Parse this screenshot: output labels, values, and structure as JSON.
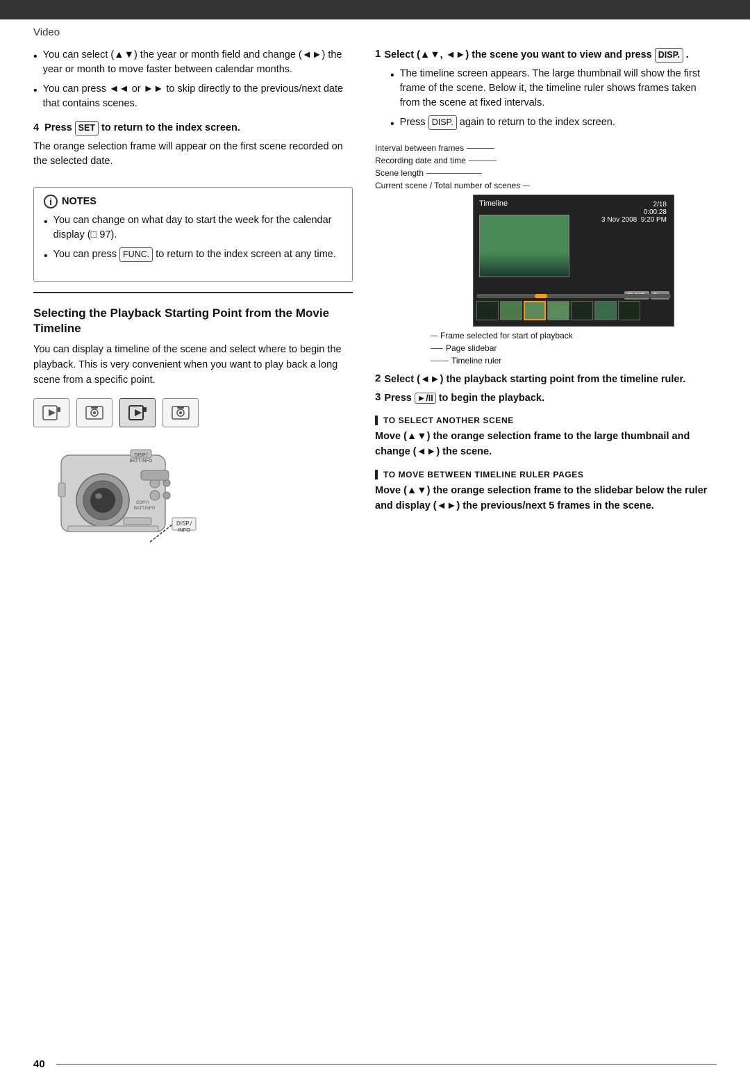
{
  "page": {
    "header": "Video",
    "page_number": "40",
    "top_bar_color": "#333"
  },
  "left_column": {
    "bullet_intro": {
      "items": [
        "You can select (▲▼) the year or month field and change (◄►) the year or month to move faster between calendar months.",
        "You can press ◄◄ or ►► to skip directly to the previous/next date that contains scenes."
      ]
    },
    "step4": {
      "heading": "4  Press SET to return to the index screen.",
      "body": "The orange selection frame will appear on the first scene recorded on the selected date."
    },
    "notes": {
      "title": "NOTES",
      "items": [
        "You can change on what day to start the week for the calendar display (□ 97).",
        "You can press FUNC. to return to the index screen at any time."
      ]
    },
    "section": {
      "heading": "Selecting the Playback Starting Point from the Movie Timeline",
      "body": "You can display a timeline of the scene and select where to begin the playback. This is very convenient when you want to play back a long scene from a specific point."
    },
    "mode_icons": [
      "▶□",
      "□",
      "▶□",
      "□"
    ],
    "mode_active_index": 2
  },
  "right_column": {
    "step1": {
      "num": "1",
      "heading": "Select (▲▼, ◄►) the scene you want to view and press DISP.",
      "bullets": [
        "The timeline screen appears. The large thumbnail will show the first frame of the scene. Below it, the timeline ruler shows frames taken from the scene at fixed intervals.",
        "Press DISP. again to return to the index screen."
      ]
    },
    "diagram": {
      "title": "Timeline",
      "date": "2/18",
      "time": "0:00:28",
      "date2": "3 Nov 2008  9:20 PM",
      "func_btn": "FUNC.",
      "sec_btn": "6sec",
      "callout_labels_top": [
        "Interval between frames",
        "Recording date and time",
        "Scene length",
        "Current scene / Total number of scenes"
      ],
      "callout_labels_bottom": [
        "Frame selected for start of playback",
        "Page slidebar",
        "Timeline ruler"
      ]
    },
    "step2": {
      "num": "2",
      "text": "Select (◄►) the playback starting point from the timeline ruler."
    },
    "step3": {
      "num": "3",
      "text": "Press ►/II to begin the playback."
    },
    "to_select_another": {
      "label": "TO SELECT ANOTHER SCENE",
      "text": "Move (▲▼) the orange selection frame to the large thumbnail and change (◄►) the scene."
    },
    "to_move_between": {
      "label": "TO MOVE BETWEEN TIMELINE RULER PAGES",
      "text": "Move (▲▼) the orange selection frame to the slidebar below the ruler and display (◄►) the previous/next 5 frames in the scene."
    }
  }
}
